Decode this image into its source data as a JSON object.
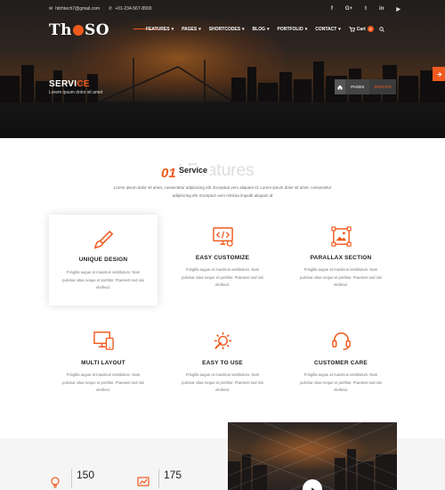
{
  "topbar": {
    "email": "hitrhtech7@gmail.com",
    "phone": "+01-234-567-8900",
    "social": [
      "f",
      "G+",
      "t",
      "in",
      "▶"
    ]
  },
  "logo": {
    "left": "Th",
    "right": "SO"
  },
  "nav": {
    "items": [
      "FEATURES",
      "PAGES",
      "SHORTCODES",
      "BLOG",
      "PORTFOLIO",
      "CONTACT"
    ],
    "cart_label": "Cart",
    "cart_count": "0"
  },
  "hero": {
    "title_main": "SERVI",
    "title_accent": "CE",
    "subtitle": "Lorem ipsum dolor sit amet",
    "breadcrumb": {
      "pages": "PAGES",
      "current": "SERVICE"
    }
  },
  "section": {
    "number": "01",
    "title": "Service",
    "ghost": "t Features",
    "description": "Lorem ipsum dolor sit amet, consectetur adipisicing elit. Excepturi vero aliquam id. Lorem ipsum dolor sit amet, consectetur adipisicing elit. Excepturi vero minima impedit aliquam id"
  },
  "features": [
    {
      "title": "UNIQUE DESIGN",
      "icon": "paint-brush-icon",
      "text": "Fringilla augue at maximus vestibulum. Nam pulvinar vitae neque et porttitor. Praesent sed nisi eleifend."
    },
    {
      "title": "EASY CUSTOMIZE",
      "icon": "code-monitor-icon",
      "text": "Fringilla augue at maximus vestibulum. Nam pulvinar vitae neque et porttitor. Praesent sed nisi eleifend."
    },
    {
      "title": "PARALLAX SECTION",
      "icon": "image-frame-icon",
      "text": "Fringilla augue at maximus vestibulum. Nam pulvinar vitae neque et porttitor. Praesent sed nisi eleifend."
    },
    {
      "title": "MULTI LAYOUT",
      "icon": "devices-icon",
      "text": "Fringilla augue at maximus vestibulum. Nam pulvinar vitae neque et porttitor. Praesent sed nisi eleifend."
    },
    {
      "title": "EASY TO USE",
      "icon": "tools-icon",
      "text": "Fringilla augue at maximus vestibulum. Nam pulvinar vitae neque et porttitor. Praesent sed nisi eleifend."
    },
    {
      "title": "CUSTOMER CARE",
      "icon": "headset-icon",
      "text": "Fringilla augue at maximus vestibulum. Nam pulvinar vitae neque et porttitor. Praesent sed nisi eleifend."
    }
  ],
  "stats": [
    {
      "value": "150",
      "label": ""
    },
    {
      "value": "175",
      "label": ""
    }
  ],
  "colors": {
    "accent": "#f05a1e",
    "text": "#222222"
  }
}
